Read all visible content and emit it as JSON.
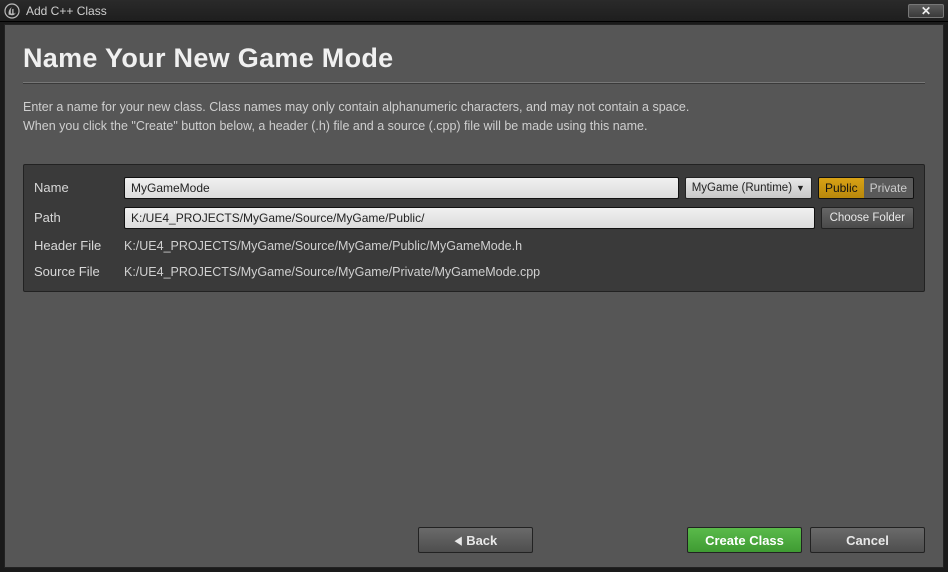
{
  "window": {
    "title": "Add C++ Class"
  },
  "dialog": {
    "title": "Name Your New Game Mode",
    "instruction_line1": "Enter a name for your new class. Class names may only contain alphanumeric characters, and may not contain a space.",
    "instruction_line2": "When you click the \"Create\" button below, a header (.h) file and a source (.cpp) file will be made using this name."
  },
  "form": {
    "name_label": "Name",
    "name_value": "MyGameMode",
    "module_selected": "MyGame (Runtime)",
    "visibility": {
      "public_label": "Public",
      "private_label": "Private",
      "selected": "Public"
    },
    "path_label": "Path",
    "path_value": "K:/UE4_PROJECTS/MyGame/Source/MyGame/Public/",
    "choose_folder_label": "Choose Folder",
    "header_label": "Header File",
    "header_value": "K:/UE4_PROJECTS/MyGame/Source/MyGame/Public/MyGameMode.h",
    "source_label": "Source File",
    "source_value": "K:/UE4_PROJECTS/MyGame/Source/MyGame/Private/MyGameMode.cpp"
  },
  "buttons": {
    "back": "Back",
    "create": "Create Class",
    "cancel": "Cancel"
  }
}
